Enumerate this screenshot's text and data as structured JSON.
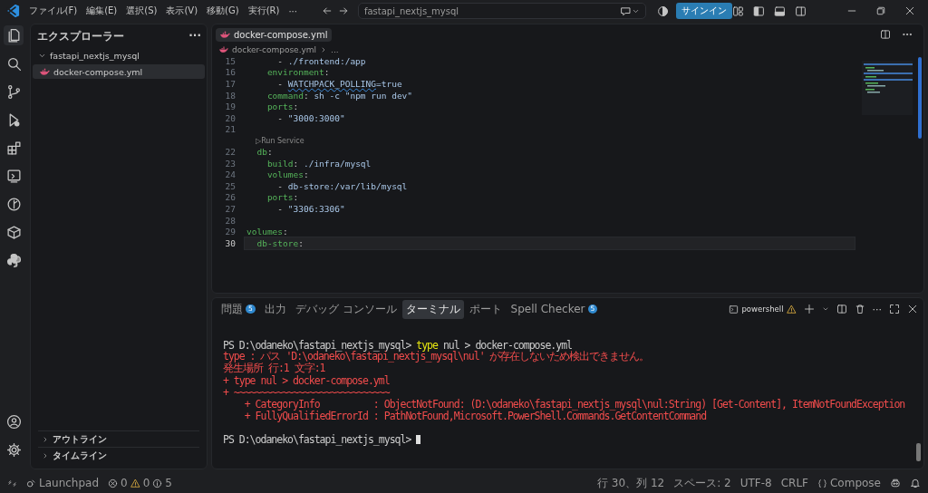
{
  "title_bar": {
    "menus": [
      "ファイル(F)",
      "編集(E)",
      "選択(S)",
      "表示(V)",
      "移動(G)",
      "実行(R)"
    ],
    "more": "···",
    "search": "fastapi_nextjs_mysql",
    "sign_in": "サインイン"
  },
  "sidebar": {
    "title": "エクスプローラー",
    "more": "···",
    "folder": {
      "label": "fastapi_nextjs_mysql",
      "expanded": true,
      "children": [
        {
          "label": "docker-compose.yml",
          "selected": true
        }
      ]
    },
    "sections": [
      {
        "label": "アウトライン",
        "expanded": false
      },
      {
        "label": "タイムライン",
        "expanded": false
      }
    ]
  },
  "editor": {
    "tabs": [
      {
        "label": "docker-compose.yml",
        "selected": true
      }
    ],
    "breadcrumb": [
      "docker-compose.yml",
      "..."
    ],
    "lines": [
      {
        "kind": "code",
        "number": "15",
        "current": false,
        "code": [
          {
            "kind": "plain",
            "t": "      - "
          },
          {
            "kind": "value",
            "t": "./frontend:/app"
          }
        ]
      },
      {
        "kind": "code",
        "number": "16",
        "current": false,
        "code": [
          {
            "kind": "key",
            "t": "    environment"
          },
          {
            "kind": "plain",
            "t": ":"
          }
        ]
      },
      {
        "kind": "code",
        "number": "17",
        "current": false,
        "code": [
          {
            "kind": "plain",
            "t": "      - "
          },
          {
            "kind": "warn",
            "t": "WATCHPACK_POLLING"
          },
          {
            "kind": "value",
            "t": "=true"
          }
        ]
      },
      {
        "kind": "code",
        "number": "18",
        "current": false,
        "code": [
          {
            "kind": "key",
            "t": "    command"
          },
          {
            "kind": "plain",
            "t": ": "
          },
          {
            "kind": "value",
            "t": "sh -c \"npm run dev\""
          }
        ]
      },
      {
        "kind": "code",
        "number": "19",
        "current": false,
        "code": [
          {
            "kind": "key",
            "t": "    ports"
          },
          {
            "kind": "plain",
            "t": ":"
          }
        ]
      },
      {
        "kind": "code",
        "number": "20",
        "current": false,
        "code": [
          {
            "kind": "plain",
            "t": "      - "
          },
          {
            "kind": "value",
            "t": "\"3000:3000\""
          }
        ]
      },
      {
        "kind": "code",
        "number": "21",
        "current": false
      },
      {
        "kind": "lens",
        "text": "▷Run Service"
      },
      {
        "kind": "code",
        "number": "22",
        "current": false,
        "code": [
          {
            "kind": "key",
            "t": "  db"
          },
          {
            "kind": "plain",
            "t": ":"
          }
        ]
      },
      {
        "kind": "code",
        "number": "23",
        "current": false,
        "code": [
          {
            "kind": "key",
            "t": "    build"
          },
          {
            "kind": "plain",
            "t": ": "
          },
          {
            "kind": "value",
            "t": "./infra/mysql"
          }
        ]
      },
      {
        "kind": "code",
        "number": "24",
        "current": false,
        "code": [
          {
            "kind": "key",
            "t": "    volumes"
          },
          {
            "kind": "plain",
            "t": ":"
          }
        ]
      },
      {
        "kind": "code",
        "number": "25",
        "current": false,
        "code": [
          {
            "kind": "plain",
            "t": "      - "
          },
          {
            "kind": "value",
            "t": "db-store:/var/lib/mysql"
          }
        ]
      },
      {
        "kind": "code",
        "number": "26",
        "current": false,
        "code": [
          {
            "kind": "key",
            "t": "    ports"
          },
          {
            "kind": "plain",
            "t": ":"
          }
        ]
      },
      {
        "kind": "code",
        "number": "27",
        "current": false,
        "code": [
          {
            "kind": "plain",
            "t": "      - "
          },
          {
            "kind": "value",
            "t": "\"3306:3306\""
          }
        ]
      },
      {
        "kind": "code",
        "number": "28",
        "current": false
      },
      {
        "kind": "code",
        "number": "29",
        "current": false,
        "code": [
          {
            "kind": "key",
            "t": "volumes"
          },
          {
            "kind": "plain",
            "t": ":"
          }
        ]
      },
      {
        "kind": "code",
        "number": "30",
        "current": true,
        "code": [
          {
            "kind": "key",
            "t": "  db-store"
          },
          {
            "kind": "plain",
            "t": ":"
          }
        ]
      }
    ]
  },
  "panel": {
    "tabs": [
      {
        "label": "問題",
        "badge": "5",
        "selected": false
      },
      {
        "label": "出力",
        "selected": false
      },
      {
        "label": "デバッグ コンソール",
        "selected": false
      },
      {
        "label": "ターミナル",
        "selected": true
      },
      {
        "label": "ポート",
        "selected": false
      },
      {
        "label": "Spell Checker",
        "badge": "5",
        "selected": false
      }
    ],
    "terminal_name": "powershell",
    "more": "···",
    "terminal": [
      {
        "kind": "blank"
      },
      {
        "kind": "line",
        "parts": [
          {
            "kind": "plain",
            "t": "PS D:\\odaneko\\fastapi_nextjs_mysql> "
          },
          {
            "kind": "cmd",
            "t": "type"
          },
          {
            "kind": "plain",
            "t": " nul > docker-compose.yml"
          }
        ]
      },
      {
        "kind": "line",
        "parts": [
          {
            "kind": "error",
            "t": "type : パス 'D:\\odaneko\\fastapi_nextjs_mysql\\nul' が存在しないため検出できません。"
          }
        ]
      },
      {
        "kind": "line",
        "parts": [
          {
            "kind": "error",
            "t": "発生場所 行:1 文字:1"
          }
        ]
      },
      {
        "kind": "line",
        "parts": [
          {
            "kind": "error",
            "t": "+ type nul > docker-compose.yml"
          }
        ]
      },
      {
        "kind": "line",
        "parts": [
          {
            "kind": "error",
            "t": "+ ~~~~~~~~~~~~~~~~~~~~~~~~~~~~~"
          }
        ]
      },
      {
        "kind": "line",
        "parts": [
          {
            "kind": "error",
            "t": "    + CategoryInfo          : ObjectNotFound: (D:\\odaneko\\fastapi_nextjs_mysql\\nul:String) [Get-Content], ItemNotFoundException"
          }
        ]
      },
      {
        "kind": "line",
        "parts": [
          {
            "kind": "error",
            "t": "    + FullyQualifiedErrorId : PathNotFound,Microsoft.PowerShell.Commands.GetContentCommand"
          }
        ]
      },
      {
        "kind": "blank"
      },
      {
        "kind": "prompt",
        "parts": [
          {
            "kind": "plain",
            "t": "PS D:\\odaneko\\fastapi_nextjs_mysql> "
          }
        ]
      }
    ]
  },
  "status_bar": {
    "launchpad": "Launchpad",
    "errors": "0",
    "warnings": "0",
    "info": "5",
    "position": "行 30、列 12",
    "spaces": "スペース: 2",
    "encoding": "UTF-8",
    "eol": "CRLF",
    "language": "Compose"
  }
}
